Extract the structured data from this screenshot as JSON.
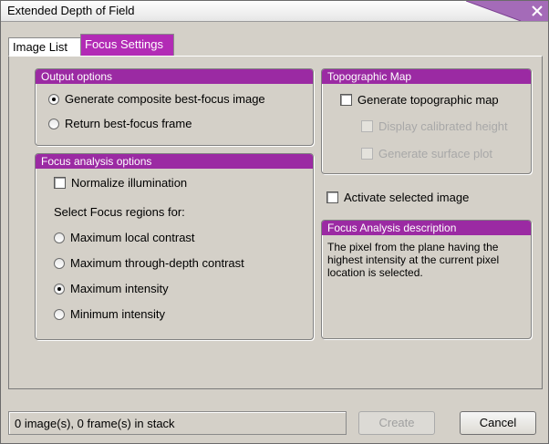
{
  "window": {
    "title": "Extended Depth of Field"
  },
  "tabs": [
    {
      "label": "Image List",
      "active": false
    },
    {
      "label": "Focus Settings",
      "active": true
    }
  ],
  "output_options": {
    "header": "Output options",
    "options": [
      {
        "label": "Generate composite best-focus image",
        "selected": true
      },
      {
        "label": "Return best-focus frame",
        "selected": false
      }
    ]
  },
  "focus_analysis": {
    "header": "Focus analysis options",
    "normalize_label": "Normalize illumination",
    "normalize_checked": false,
    "select_label": "Select Focus regions for:",
    "regions": [
      {
        "label": "Maximum local contrast",
        "selected": false
      },
      {
        "label": "Maximum through-depth contrast",
        "selected": false
      },
      {
        "label": "Maximum intensity",
        "selected": true
      },
      {
        "label": "Minimum intensity",
        "selected": false
      }
    ]
  },
  "topographic_map": {
    "header": "Topographic Map",
    "generate_label": "Generate topographic map",
    "display_height_label": "Display calibrated height",
    "surface_plot_label": "Generate surface plot"
  },
  "activate_label": "Activate selected image",
  "description": {
    "header": "Focus Analysis description",
    "text": "The pixel from the plane having the highest intensity at the current pixel location is selected."
  },
  "status": {
    "text": "0 image(s), 0 frame(s) in stack"
  },
  "buttons": {
    "create": "Create",
    "cancel": "Cancel"
  },
  "colors": {
    "accent": "#9b2aa3",
    "tab_active": "#b22bb5",
    "close_tab": "#a46bb8"
  }
}
